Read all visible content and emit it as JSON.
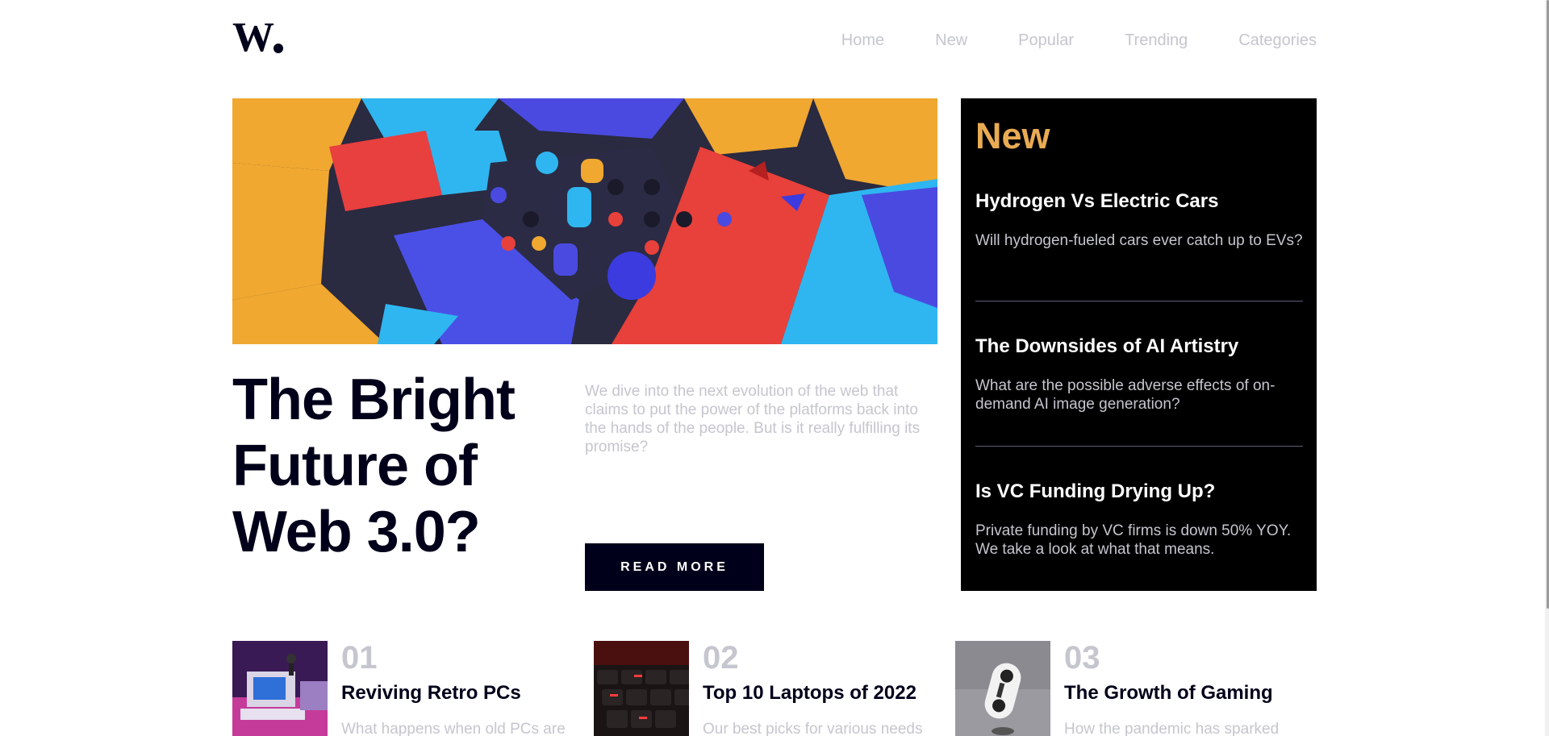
{
  "brand": {
    "logo_text": "W.",
    "accent_color": "#e9ab53",
    "dark_color": "#00001a",
    "muted_color": "#c5c6ce"
  },
  "nav": {
    "items": [
      "Home",
      "New",
      "Popular",
      "Trending",
      "Categories"
    ]
  },
  "hero": {
    "image": "abstract-3d-blocks-image",
    "title": "The Bright Future of Web 3.0?",
    "lede": "We dive into the next evolution of the web that claims to put the power of the platforms back into the hands of the people. But is it really fulfilling its promise?",
    "button_label": "READ MORE"
  },
  "new_panel": {
    "title": "New",
    "items": [
      {
        "title": "Hydrogen Vs Electric Cars",
        "text": "Will hydrogen-fueled cars ever catch up to EVs?"
      },
      {
        "title": "The Downsides of AI Artistry",
        "text": "What are the possible adverse effects of on-demand AI image generation?"
      },
      {
        "title": "Is VC Funding Drying Up?",
        "text": "Private funding by VC firms is down 50% YOY. We take a look at what that means."
      }
    ]
  },
  "articles": [
    {
      "number": "01",
      "title": "Reviving Retro PCs",
      "text": "What happens when old PCs are",
      "image": "retro-pc-image"
    },
    {
      "number": "02",
      "title": "Top 10 Laptops of 2022",
      "text": "Our best picks for various needs",
      "image": "laptop-keyboard-image"
    },
    {
      "number": "03",
      "title": "The Growth of Gaming",
      "text": "How the pandemic has sparked",
      "image": "game-controller-image"
    }
  ]
}
